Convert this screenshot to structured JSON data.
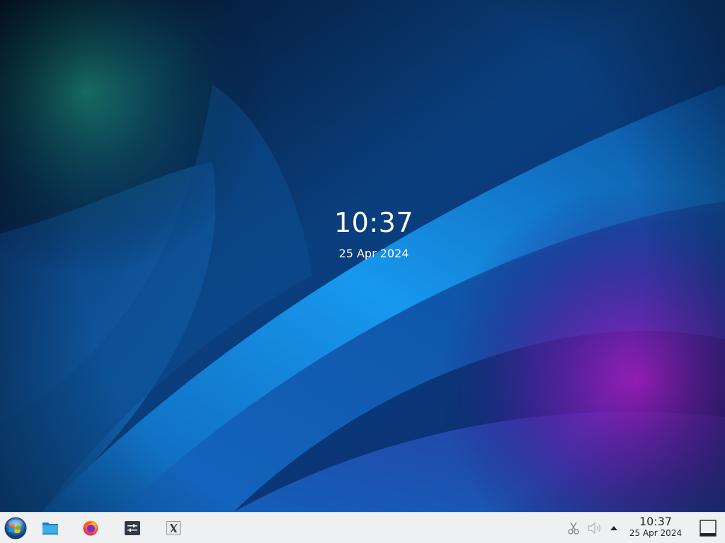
{
  "desktop": {
    "clock_time": "10:37",
    "clock_date": "25 Apr 2024"
  },
  "taskbar": {
    "start_icon": "start-orb-icon",
    "tasks": [
      {
        "icon": "folder-icon"
      },
      {
        "icon": "firefox-icon"
      },
      {
        "icon": "settings-sliders-icon"
      },
      {
        "icon": "x-app-icon"
      }
    ],
    "tray": {
      "items": [
        {
          "icon": "scissors-icon"
        },
        {
          "icon": "volume-icon"
        },
        {
          "icon": "chevron-up-icon"
        }
      ],
      "clock_time": "10:37",
      "clock_date": "25 Apr 2024"
    },
    "show_desktop_icon": "show-desktop-icon"
  },
  "colors": {
    "wallpaper_dark": "#04122e",
    "wallpaper_blue": "#1a8fe0",
    "wallpaper_purple": "#8a1fb4",
    "wallpaper_teal": "#1a7a6e",
    "taskbar_bg": "#eff0f1",
    "taskbar_text": "#232627"
  }
}
